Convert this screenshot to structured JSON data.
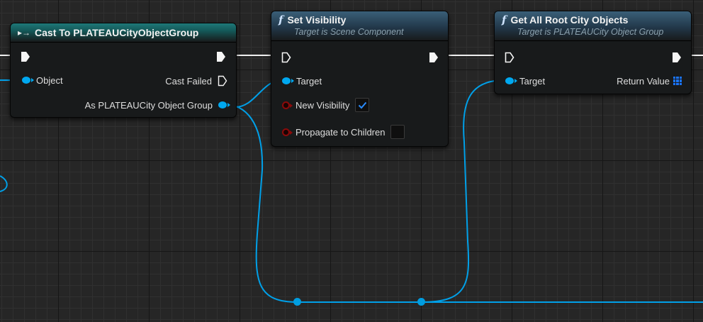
{
  "colors": {
    "background": "#262626",
    "exec_wire": "#f0f0f0",
    "object_wire": "#00a0e8",
    "cast_header": "#155e5e",
    "function_header": "#1e3a52",
    "bool_pin": "#8c0a0a",
    "array_pin": "#1a74ff"
  },
  "cast_node": {
    "icon": "cast-arrow-icon",
    "title": "Cast To PLATEAUCityObjectGroup",
    "pin_object": "Object",
    "pin_cast_failed": "Cast Failed",
    "pin_as": "As PLATEAUCity Object Group"
  },
  "set_visibility_node": {
    "icon": "function-icon",
    "title": "Set Visibility",
    "subtitle": "Target is Scene Component",
    "pin_target": "Target",
    "pin_new_visibility": "New Visibility",
    "new_visibility_checked": true,
    "pin_propagate": "Propagate to Children",
    "propagate_checked": false
  },
  "get_root_node": {
    "icon": "function-icon",
    "title": "Get All Root City Objects",
    "subtitle": "Target is PLATEAUCity Object Group",
    "pin_target": "Target",
    "pin_return": "Return Value"
  },
  "reroute_nodes": [
    "reroute-node-1",
    "reroute-node-2"
  ]
}
